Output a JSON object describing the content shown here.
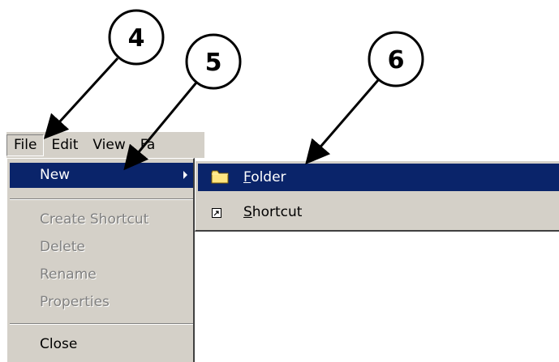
{
  "menubar": {
    "items": [
      {
        "label": "File"
      },
      {
        "label": "Edit"
      },
      {
        "label": "View"
      },
      {
        "label": "Fa"
      }
    ]
  },
  "file_menu": {
    "new_label": "New",
    "create_shortcut_label": "Create Shortcut",
    "delete_label": "Delete",
    "rename_label": "Rename",
    "properties_label": "Properties",
    "close_label": "Close"
  },
  "new_submenu": {
    "folder": {
      "mnemonic": "F",
      "rest": "older"
    },
    "shortcut": {
      "mnemonic": "S",
      "rest": "hortcut"
    }
  },
  "callouts": {
    "step4": "4",
    "step5": "5",
    "step6": "6"
  },
  "colors": {
    "menu_face": "#d4d0c8",
    "highlight": "#0a246a",
    "disabled_text": "#808080",
    "folder_yellow": "#ffe680"
  },
  "icons": {
    "submenu_arrow": "submenu-arrow-icon",
    "folder": "folder-icon",
    "shortcut": "shortcut-icon"
  }
}
